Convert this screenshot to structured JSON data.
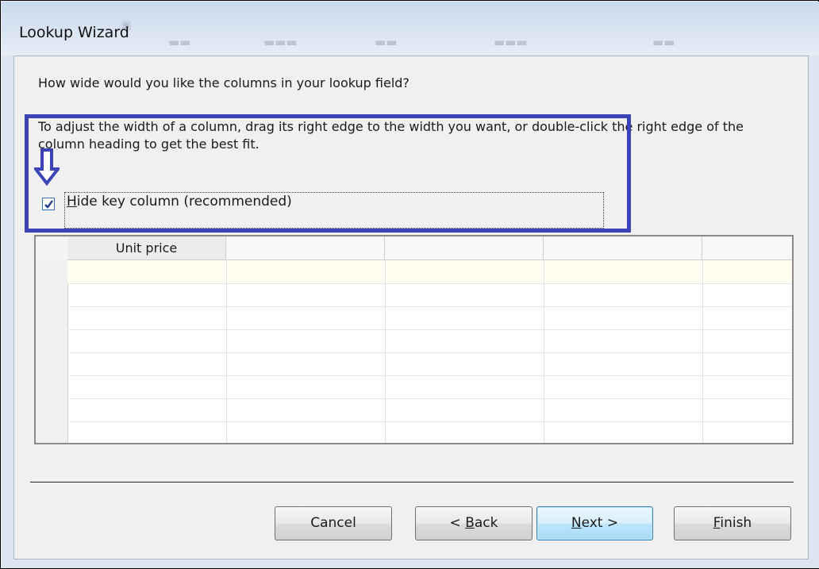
{
  "window": {
    "title": "Lookup Wizard"
  },
  "wizard": {
    "question": "How wide would you like the columns in your lookup field?",
    "instructions": "To adjust the width of a column, drag its right edge to the width you want, or double-click the right edge of the column heading to get the best fit.",
    "hide_key_column": {
      "checked": true,
      "label_accel": "H",
      "label_rest": "ide key column (recommended)"
    }
  },
  "grid": {
    "columns": [
      "Unit price",
      "",
      "",
      "",
      ""
    ],
    "rows": [
      [
        "",
        "",
        "",
        "",
        ""
      ],
      [
        "",
        "",
        "",
        "",
        ""
      ],
      [
        "",
        "",
        "",
        "",
        ""
      ],
      [
        "",
        "",
        "",
        "",
        ""
      ],
      [
        "",
        "",
        "",
        "",
        ""
      ],
      [
        "",
        "",
        "",
        "",
        ""
      ],
      [
        "",
        "",
        "",
        "",
        ""
      ],
      [
        "",
        "",
        "",
        "",
        ""
      ]
    ]
  },
  "buttons": {
    "cancel": "Cancel",
    "back_prefix": "< ",
    "back_accel": "B",
    "back_rest": "ack",
    "next_accel": "N",
    "next_rest": "ext >",
    "finish_accel": "F",
    "finish_rest": "inish"
  },
  "annotation": {
    "highlight_color": "#3b43b6"
  }
}
